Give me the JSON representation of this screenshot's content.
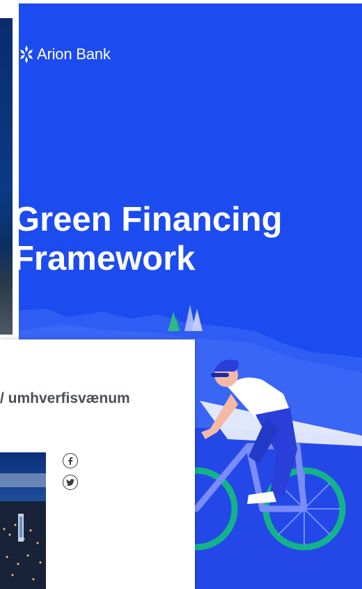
{
  "brand": {
    "name": "Arion Bank"
  },
  "poster": {
    "headline_line1": "Green Financing",
    "headline_line2": "Framework"
  },
  "article": {
    "title": "/ umhverfisvænum"
  },
  "share": {
    "facebook_icon": "facebook-icon",
    "twitter_icon": "twitter-icon"
  },
  "colors": {
    "poster_blue": "#1c4bf0",
    "text_dark": "#4b4f54",
    "wheel_green": "#13b38a"
  }
}
